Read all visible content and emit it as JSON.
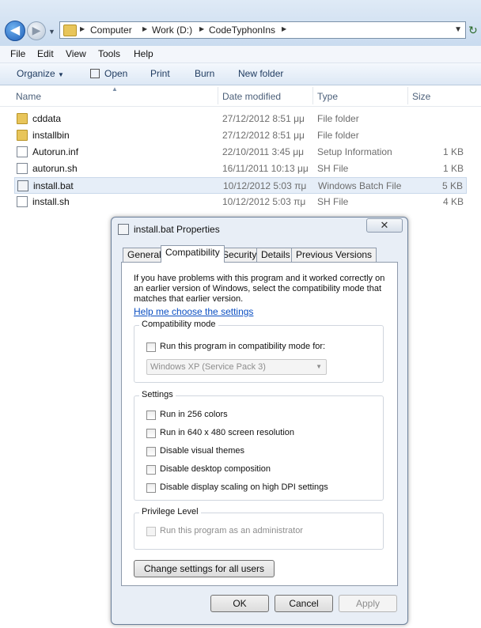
{
  "explorer": {
    "breadcrumb": [
      "Computer",
      "Work (D:)",
      "CodeTyphonIns"
    ],
    "menu": [
      "File",
      "Edit",
      "View",
      "Tools",
      "Help"
    ],
    "toolbar": {
      "organize": "Organize",
      "open": "Open",
      "print": "Print",
      "burn": "Burn",
      "new_folder": "New folder"
    },
    "columns": {
      "name": "Name",
      "date": "Date modified",
      "type": "Type",
      "size": "Size"
    },
    "files": [
      {
        "name": "cddata",
        "date": "27/12/2012 8:51 μμ",
        "type": "File folder",
        "size": "",
        "icon": "folder-icon"
      },
      {
        "name": "installbin",
        "date": "27/12/2012 8:51 μμ",
        "type": "File folder",
        "size": "",
        "icon": "folder-icon"
      },
      {
        "name": "Autorun.inf",
        "date": "22/10/2011 3:45 μμ",
        "type": "Setup Information",
        "size": "1 KB",
        "icon": "settings-file-icon"
      },
      {
        "name": "autorun.sh",
        "date": "16/11/2011 10:13 μμ",
        "type": "SH File",
        "size": "1 KB",
        "icon": "document-icon"
      },
      {
        "name": "install.bat",
        "date": "10/12/2012 5:03 πμ",
        "type": "Windows Batch File",
        "size": "5 KB",
        "icon": "batch-file-icon",
        "selected": true
      },
      {
        "name": "install.sh",
        "date": "10/12/2012 5:03 πμ",
        "type": "SH File",
        "size": "4 KB",
        "icon": "document-icon"
      }
    ]
  },
  "dialog": {
    "title": "install.bat Properties",
    "close": "✕",
    "tabs": [
      "General",
      "Compatibility",
      "Security",
      "Details",
      "Previous Versions"
    ],
    "active_tab": "Compatibility",
    "intro": "If you have problems with this program and it worked correctly on an earlier version of Windows, select the compatibility mode that matches that earlier version.",
    "help_link": "Help me choose the settings",
    "compat_group": {
      "legend": "Compatibility mode",
      "checkbox": "Run this program in compatibility mode for:",
      "combo_value": "Windows XP (Service Pack 3)"
    },
    "settings_group": {
      "legend": "Settings",
      "options": [
        "Run in 256 colors",
        "Run in 640 x 480 screen resolution",
        "Disable visual themes",
        "Disable desktop composition",
        "Disable display scaling on high DPI settings"
      ]
    },
    "privilege_group": {
      "legend": "Privilege Level",
      "checkbox": "Run this program as an administrator"
    },
    "change_all_button": "Change settings for all users",
    "buttons": {
      "ok": "OK",
      "cancel": "Cancel",
      "apply": "Apply"
    }
  }
}
